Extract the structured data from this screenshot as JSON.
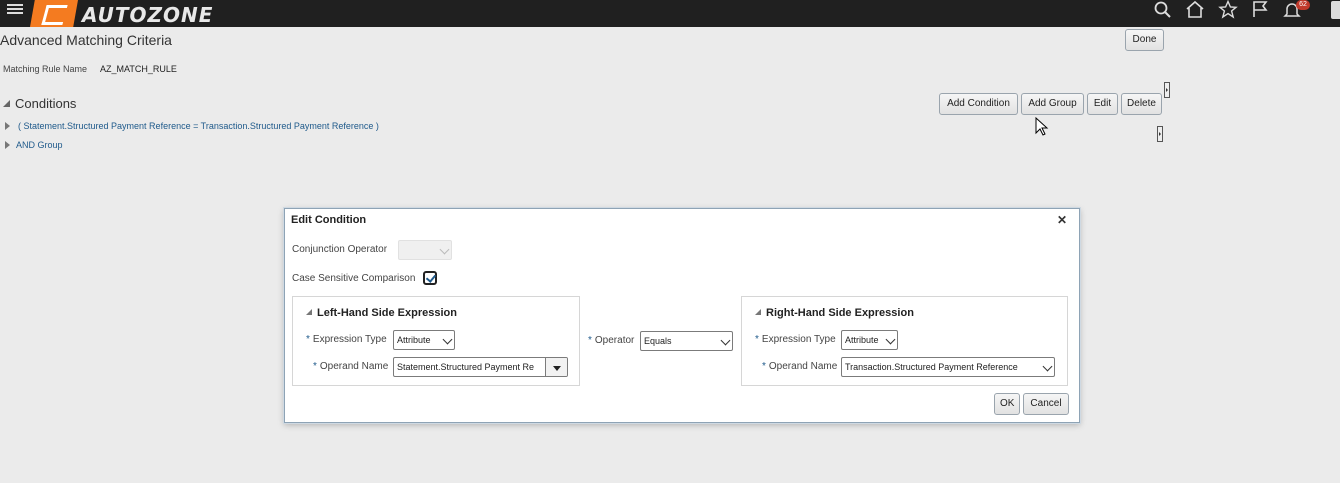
{
  "header": {
    "logo_text": "AUTOZONE",
    "notification_count": "62",
    "icons": [
      "hamburger-icon",
      "search-icon",
      "home-icon",
      "star-icon",
      "flag-icon",
      "bell-icon"
    ]
  },
  "page": {
    "title": "Advanced Matching Criteria",
    "done_label": "Done",
    "rule_name_label": "Matching Rule Name",
    "rule_name_value": "AZ_MATCH_RULE"
  },
  "conditions": {
    "heading": "Conditions",
    "toolbar": {
      "add_condition": "Add Condition",
      "add_group": "Add Group",
      "edit": "Edit",
      "delete": "Delete"
    },
    "tree": [
      {
        "label": "( Statement.Structured Payment Reference = Transaction.Structured Payment Reference )"
      },
      {
        "label": "AND Group"
      }
    ]
  },
  "dialog": {
    "title": "Edit Condition",
    "conjunction_label": "Conjunction Operator",
    "conjunction_value": "",
    "case_sensitive_label": "Case Sensitive Comparison",
    "case_sensitive_checked": true,
    "left": {
      "title": "Left-Hand Side Expression",
      "expr_type_label": "Expression Type",
      "expr_type_value": "Attribute",
      "operand_label": "Operand Name",
      "operand_value": "Statement.Structured Payment Re"
    },
    "operator_label": "Operator",
    "operator_value": "Equals",
    "right": {
      "title": "Right-Hand Side Expression",
      "expr_type_label": "Expression Type",
      "expr_type_value": "Attribute",
      "operand_label": "Operand Name",
      "operand_value": "Transaction.Structured Payment Reference"
    },
    "ok_label": "OK",
    "cancel_label": "Cancel"
  },
  "colors": {
    "topbar": "#202020",
    "brand_orange": "#f47b20",
    "link": "#1f5a8b",
    "background": "#ebebeb"
  }
}
